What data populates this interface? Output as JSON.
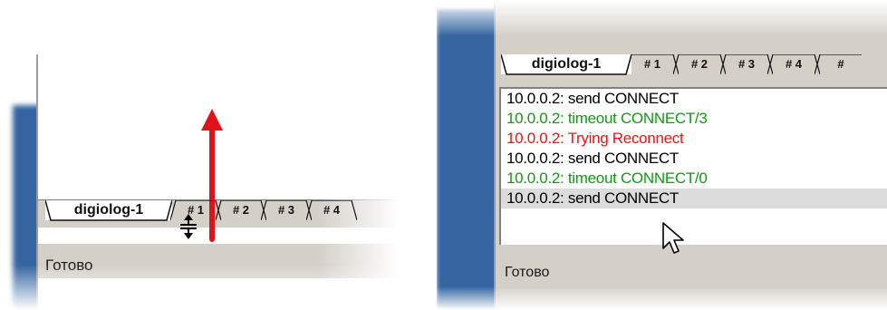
{
  "left": {
    "tabs": [
      {
        "label": "digiolog-1",
        "active": true
      },
      {
        "label": "# 1",
        "active": false
      },
      {
        "label": "# 2",
        "active": false
      },
      {
        "label": "# 3",
        "active": false
      },
      {
        "label": "# 4",
        "active": false
      }
    ],
    "status": "Готово",
    "arrow_color": "#e0131a",
    "cursor_icon": "resize-vertical-icon"
  },
  "right": {
    "tabs": [
      {
        "label": "digiolog-1",
        "active": true
      },
      {
        "label": "# 1",
        "active": false
      },
      {
        "label": "# 2",
        "active": false
      },
      {
        "label": "# 3",
        "active": false
      },
      {
        "label": "# 4",
        "active": false
      },
      {
        "label": "#",
        "active": false
      }
    ],
    "log": [
      {
        "text": "10.0.0.2: send CONNECT",
        "color": "#000000",
        "selected": false
      },
      {
        "text": "10.0.0.2: timeout CONNECT/3",
        "color": "#119a11",
        "selected": false
      },
      {
        "text": "10.0.0.2: Trying Reconnect",
        "color": "#ee1111",
        "selected": false
      },
      {
        "text": "10.0.0.2: send CONNECT",
        "color": "#000000",
        "selected": false
      },
      {
        "text": "10.0.0.2: timeout CONNECT/0",
        "color": "#119a11",
        "selected": false
      },
      {
        "text": "10.0.0.2: send CONNECT",
        "color": "#000000",
        "selected": true
      }
    ],
    "status": "Готово",
    "cursor_icon": "arrow-pointer-icon"
  }
}
